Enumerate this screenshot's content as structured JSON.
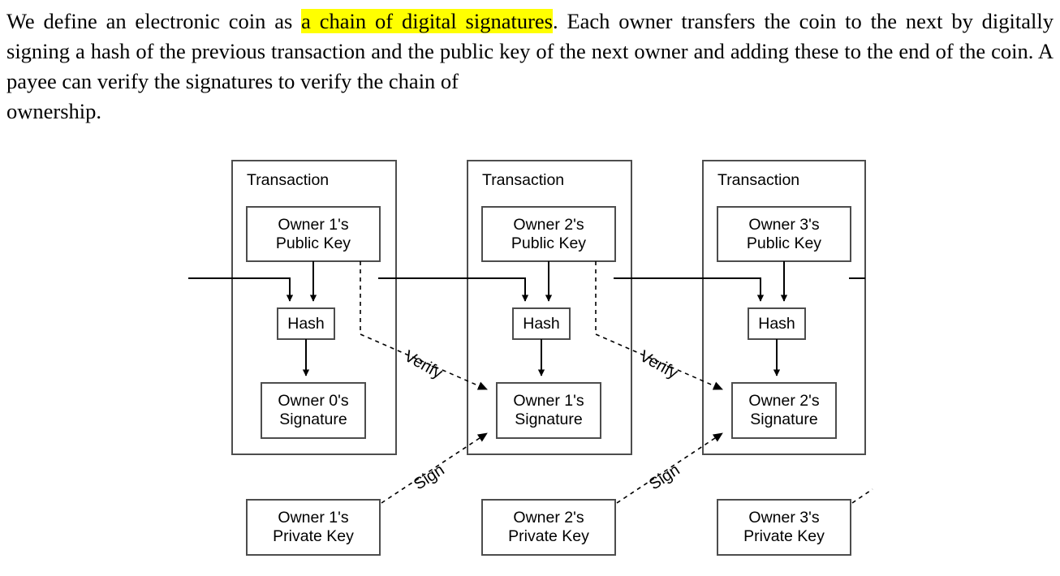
{
  "paragraph": {
    "before_highlight": "We define an electronic coin as ",
    "highlight": "a chain of digital signatures",
    "after_highlight": ".  Each owner transfers the coin to the next by digitally signing a hash of the previous transaction and the public key of the next owner and adding these to the end of the coin.  A payee can verify the signatures to verify the chain of",
    "last_line": "ownership.",
    "highlight_color": "#ffff00"
  },
  "diagram": {
    "title_label": "Transaction",
    "transactions": [
      {
        "header": "Transaction",
        "public_key": "Owner 1's\nPublic Key",
        "hash": "Hash",
        "signature": "Owner 0's\nSignature"
      },
      {
        "header": "Transaction",
        "public_key": "Owner 2's\nPublic Key",
        "hash": "Hash",
        "signature": "Owner 1's\nSignature"
      },
      {
        "header": "Transaction",
        "public_key": "Owner 3's\nPublic Key",
        "hash": "Hash",
        "signature": "Owner 2's\nSignature"
      }
    ],
    "private_keys": [
      "Owner 1's\nPrivate Key",
      "Owner 2's\nPrivate Key",
      "Owner 3's\nPrivate Key"
    ],
    "edge_labels": {
      "verify_1": "Verify",
      "verify_2": "Verify",
      "sign_1": "Sign",
      "sign_2": "Sign"
    },
    "colors": {
      "stroke": "#4d4d4d",
      "arrow": "#000000",
      "background": "#ffffff"
    }
  }
}
